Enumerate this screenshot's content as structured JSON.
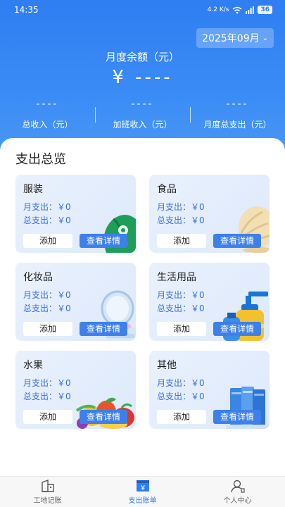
{
  "status_bar": {
    "time": "14:35",
    "network": "4.2 K/s",
    "battery": "36"
  },
  "header": {
    "month_picker": "2025年09月",
    "balance_label": "月度余额（元）",
    "balance_value": "¥ ----",
    "stats": [
      {
        "value": "----",
        "label": "总收入（元）"
      },
      {
        "value": "----",
        "label": "加班收入（元）"
      },
      {
        "value": "----",
        "label": "月度总支出（元）"
      }
    ]
  },
  "overview": {
    "title": "支出总览",
    "cards": [
      {
        "name": "服装",
        "monthly": "月支出：￥0",
        "total": "总支出：￥0",
        "add_label": "添加",
        "detail_label": "查看详情",
        "icon": "clothing-icon"
      },
      {
        "name": "食品",
        "monthly": "月支出：￥0",
        "total": "总支出：￥0",
        "add_label": "添加",
        "detail_label": "查看详情",
        "icon": "food-icon"
      },
      {
        "name": "化妆品",
        "monthly": "月支出：￥0",
        "total": "总支出：￥0",
        "add_label": "添加",
        "detail_label": "查看详情",
        "icon": "cosmetics-icon"
      },
      {
        "name": "生活用品",
        "monthly": "月支出：￥0",
        "total": "总支出：￥0",
        "add_label": "添加",
        "detail_label": "查看详情",
        "icon": "daily-goods-icon"
      },
      {
        "name": "水果",
        "monthly": "月支出：￥0",
        "total": "总支出：￥0",
        "add_label": "添加",
        "detail_label": "查看详情",
        "icon": "fruit-icon"
      },
      {
        "name": "其他",
        "monthly": "月支出：￥0",
        "total": "总支出：￥0",
        "add_label": "添加",
        "detail_label": "查看详情",
        "icon": "other-icon"
      }
    ]
  },
  "tabbar": {
    "items": [
      {
        "label": "工地记账",
        "icon": "building-icon",
        "active": false
      },
      {
        "label": "支出账单",
        "icon": "bill-icon",
        "active": true
      },
      {
        "label": "个人中心",
        "icon": "user-icon",
        "active": false
      }
    ]
  },
  "colors": {
    "primary": "#2f7ef2",
    "card_bg": "#e6effc",
    "detail_button": "#3d80ea"
  }
}
